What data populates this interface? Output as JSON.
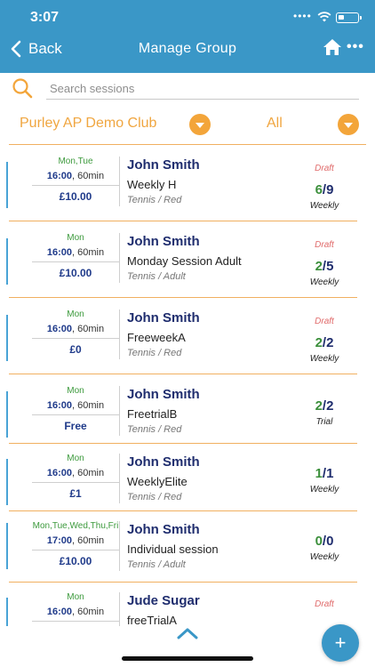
{
  "status_bar": {
    "time": "3:07"
  },
  "nav": {
    "back_label": "Back",
    "title": "Manage Group"
  },
  "search": {
    "placeholder": "Search sessions",
    "value": ""
  },
  "filters": {
    "club": "Purley AP Demo Club",
    "type": "All"
  },
  "sessions": [
    {
      "days": "Mon,Tue",
      "time": "16:00",
      "duration": ", 60min",
      "price": "£10.00",
      "coach": "John Smith",
      "name": "Weekly H",
      "sport": "Tennis / Red",
      "status": "Draft",
      "filled": "6",
      "capacity": "/9",
      "frequency": "Weekly"
    },
    {
      "days": "Mon",
      "time": "16:00",
      "duration": ", 60min",
      "price": "£10.00",
      "coach": "John Smith",
      "name": "Monday Session Adult",
      "sport": "Tennis / Adult",
      "status": "Draft",
      "filled": "2",
      "capacity": "/5",
      "frequency": "Weekly"
    },
    {
      "days": "Mon",
      "time": "16:00",
      "duration": ", 60min",
      "price": "£0",
      "coach": "John Smith",
      "name": "FreeweekA",
      "sport": "Tennis / Red",
      "status": "Draft",
      "filled": "2",
      "capacity": "/2",
      "frequency": "Weekly"
    },
    {
      "days": "Mon",
      "time": "16:00",
      "duration": ", 60min",
      "price": "Free",
      "coach": "John Smith",
      "name": "FreetrialB",
      "sport": "Tennis / Red",
      "status": "",
      "filled": "2",
      "capacity": "/2",
      "frequency": "Trial"
    },
    {
      "days": "Mon",
      "time": "16:00",
      "duration": ", 60min",
      "price": "£1",
      "coach": "John Smith",
      "name": "WeeklyElite",
      "sport": "Tennis / Red",
      "status": "",
      "filled": "1",
      "capacity": "/1",
      "frequency": "Weekly"
    },
    {
      "days": "Mon,Tue,Wed,Thu,Fri",
      "time": "17:00",
      "duration": ", 60min",
      "price": "£10.00",
      "coach": "John Smith",
      "name": "Individual session",
      "sport": "Tennis / Adult",
      "status": "",
      "filled": "0",
      "capacity": "/0",
      "frequency": "Weekly"
    },
    {
      "days": "Mon",
      "time": "16:00",
      "duration": ", 60min",
      "price": "",
      "coach": "Jude Sugar",
      "name": "freeTrialA",
      "sport": "",
      "status": "Draft",
      "filled": "",
      "capacity": "",
      "frequency": ""
    }
  ],
  "fab": {
    "label": "+"
  },
  "colors": {
    "header": "#3a97c7",
    "accent_orange": "#f3a53a",
    "draft_red": "#e06a6a",
    "count_green": "#3b8f3b",
    "navy": "#1f2d6e"
  },
  "icons": {
    "back": "chevron-left-icon",
    "home": "home-icon",
    "more": "more-dots-icon",
    "search": "search-icon",
    "dropdown": "chevron-down-icon",
    "collapse": "chevron-up-icon",
    "add": "plus-icon"
  }
}
